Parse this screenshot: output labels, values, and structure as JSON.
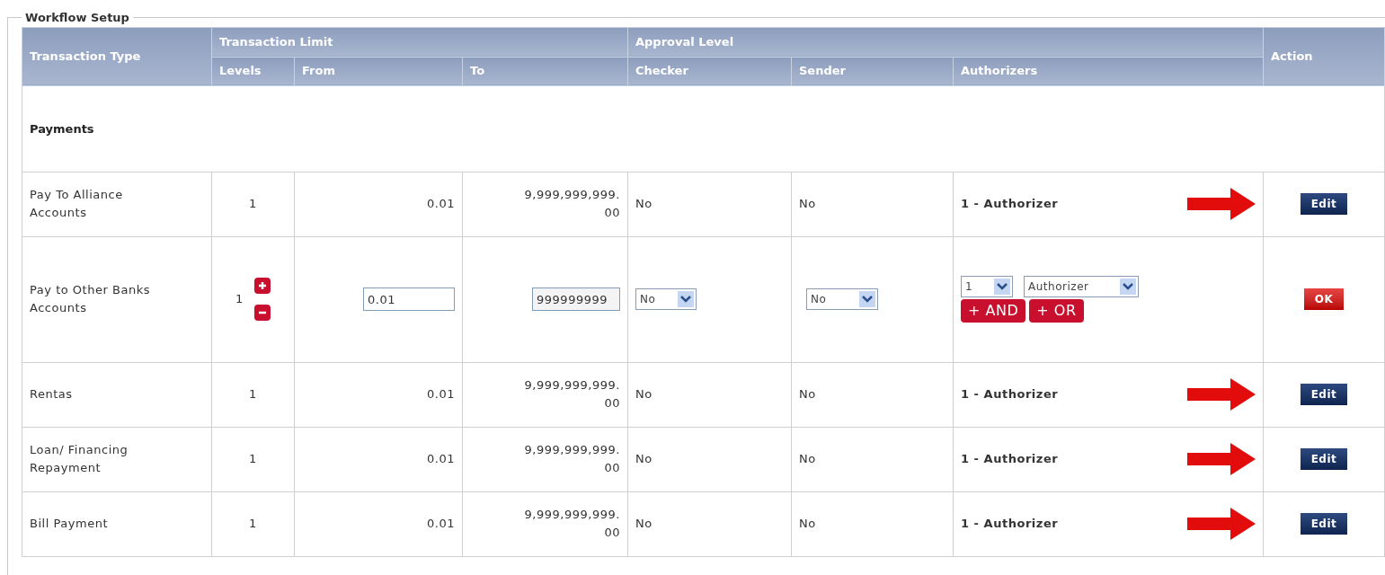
{
  "fieldset": {
    "legend": "Workflow Setup"
  },
  "table": {
    "header_groups": [
      {
        "label": "Transaction Type"
      },
      {
        "label": "Transaction Limit"
      },
      {
        "label": "Approval Level"
      },
      {
        "label": "Action"
      }
    ],
    "columns": [
      "Levels",
      "From",
      "To",
      "Checker",
      "Sender",
      "Authorizers"
    ],
    "section": "Payments",
    "rows": [
      {
        "kind": "view",
        "type": "Pay To Alliance Accounts",
        "levels": "1",
        "from": "0.01",
        "to": "9,999,999,999.00",
        "checker": "No",
        "sender": "No",
        "authorizers": "1 - Authorizer",
        "action": "Edit",
        "arrow": true
      },
      {
        "kind": "edit",
        "type": "Pay to Other Banks Accounts",
        "levels": "1",
        "from": "0.01",
        "to": "999999999",
        "checker": "No",
        "sender": "No",
        "auth_count": "1",
        "auth_role": "Authorizer",
        "and_button": "+ AND",
        "or_button": "+ OR",
        "action": "OK",
        "arrow": false
      },
      {
        "kind": "view",
        "type": "Rentas",
        "levels": "1",
        "from": "0.01",
        "to": "9,999,999,999.00",
        "checker": "No",
        "sender": "No",
        "authorizers": "1 - Authorizer",
        "action": "Edit",
        "arrow": true
      },
      {
        "kind": "view",
        "type": "Loan/ Financing Repayment",
        "levels": "1",
        "from": "0.01",
        "to": "9,999,999,999.00",
        "checker": "No",
        "sender": "No",
        "authorizers": "1 - Authorizer",
        "action": "Edit",
        "arrow": true
      },
      {
        "kind": "view",
        "type": "Bill Payment",
        "levels": "1",
        "from": "0.01",
        "to": "9,999,999,999.00",
        "checker": "No",
        "sender": "No",
        "authorizers": "1 - Authorizer",
        "action": "Edit",
        "arrow": true
      }
    ]
  }
}
